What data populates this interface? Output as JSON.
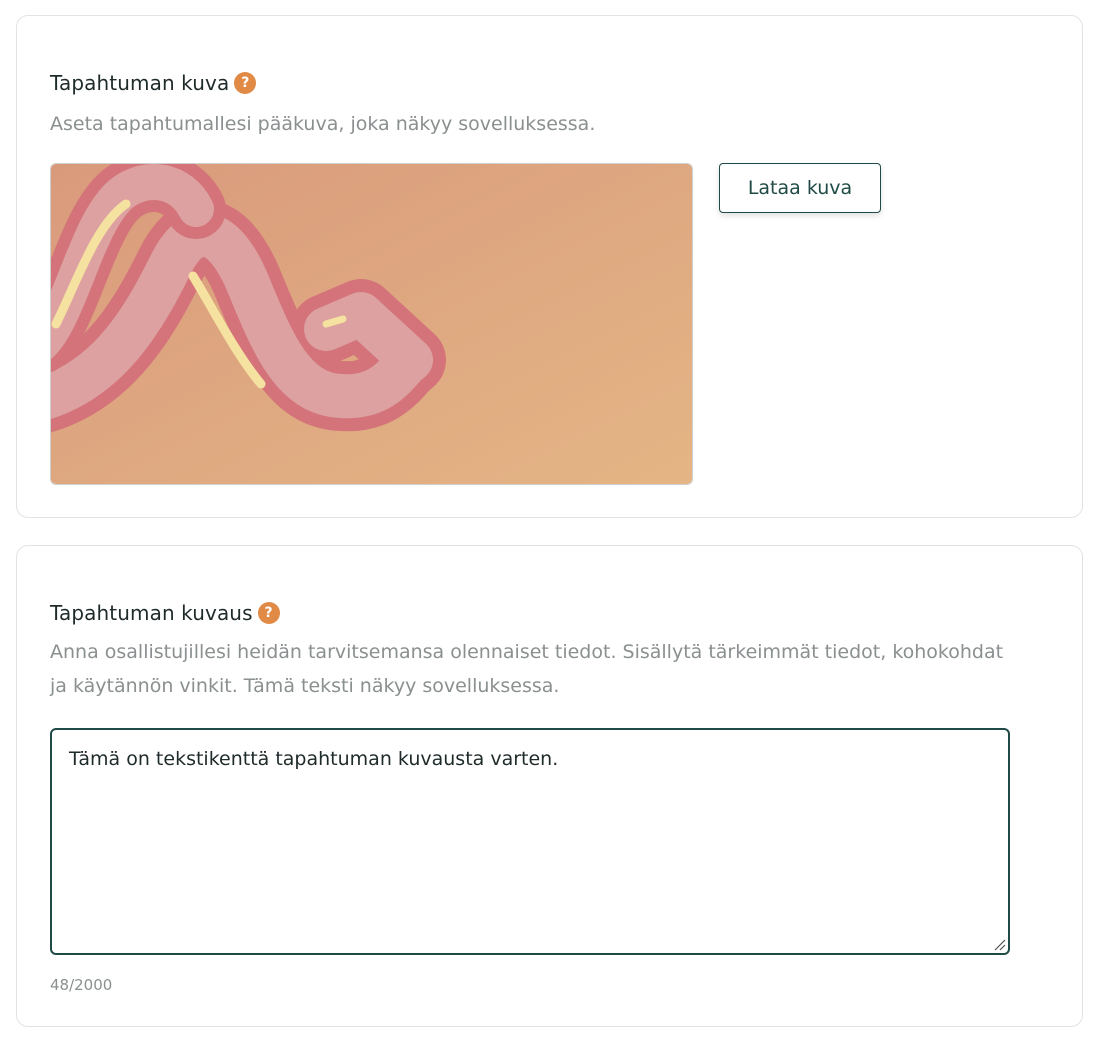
{
  "image_section": {
    "title": "Tapahtuman kuva",
    "help_icon": "question-icon",
    "help_text": "Aseta tapahtumallesi pääkuva, joka näkyy sovelluksessa.",
    "upload_button_label": "Lataa kuva"
  },
  "description_section": {
    "title": "Tapahtuman kuvaus",
    "help_icon": "question-icon",
    "help_text": "Anna osallistujillesi heidän tarvitsemansa olennaiset tiedot. Sisällytä tärkeimmät tiedot, kohokohdat ja käytännön vinkit. Tämä teksti näkyy sovelluksessa.",
    "textarea_value": "Tämä on tekstikenttä tapahtuman kuvausta varten.",
    "char_count": "48/2000"
  },
  "colors": {
    "accent": "#1f4a46",
    "help_icon": "#e08a46",
    "image_bg_start": "#d99a7c",
    "image_bg_end": "#e2b184",
    "ribbon_stroke": "#d4747a",
    "ribbon_fill": "#dca1a0",
    "ribbon_highlight": "#f6e2a0"
  }
}
